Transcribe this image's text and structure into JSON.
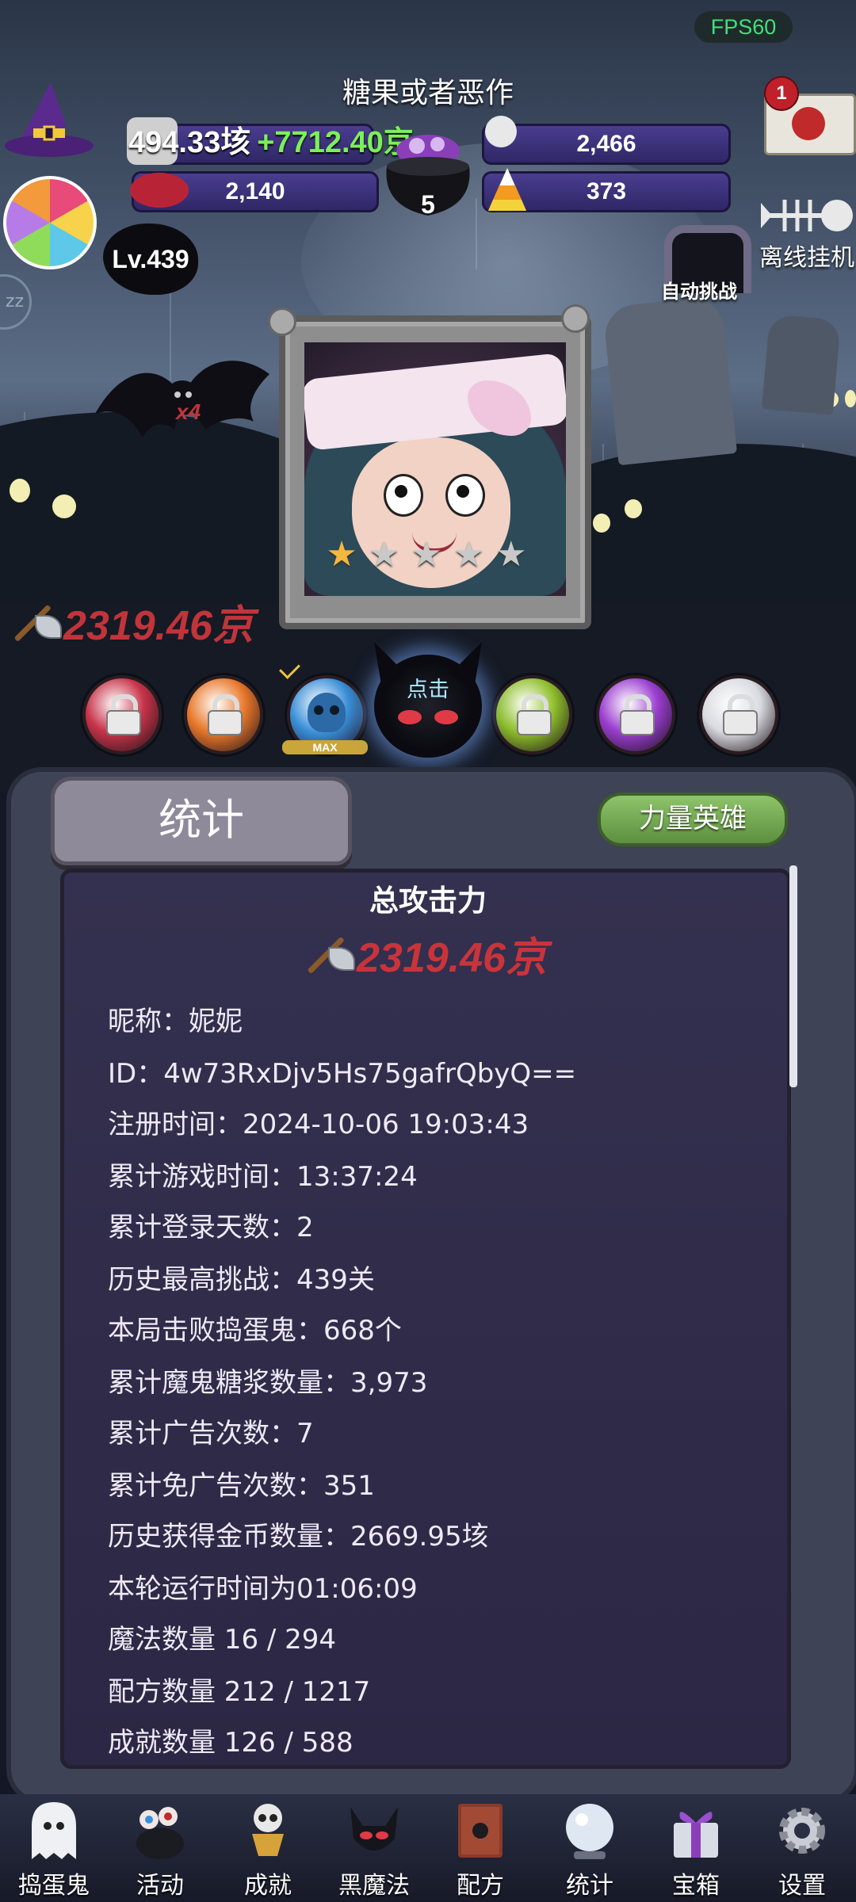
{
  "status": {
    "fps": "FPS60"
  },
  "header": {
    "title": "糖果或者恶作",
    "gold": "494.33垓",
    "gold_rate": "+7712.40京",
    "skulls": "2,466",
    "bats": "2,140",
    "cauldron_count": "5",
    "candy_corn": "373",
    "mail_badge": "1",
    "level": "Lv.439",
    "auto_challenge": "自动挑战",
    "offline_idle": "离线挂机"
  },
  "hero": {
    "stars_filled": 1,
    "stars_total": 5,
    "attack": "2319.46京",
    "max_label": "MAX",
    "tap_label": "点击"
  },
  "bat_multiplier": "x4",
  "orbs": [
    {
      "color": "#c8344a",
      "locked": true
    },
    {
      "color": "#e8782a",
      "locked": true
    },
    {
      "color": "#3a8fd8",
      "locked": false,
      "max": true
    },
    {
      "color": "#8fbf2c",
      "locked": true
    },
    {
      "color": "#9a3ed0",
      "locked": true
    },
    {
      "color": "#d9dbe0",
      "locked": true
    }
  ],
  "panel": {
    "tab_active": "统计",
    "tab_other": "力量英雄",
    "total_attack_title": "总攻击力",
    "total_attack_value": "2319.46京",
    "stats": [
      "昵称：妮妮",
      "ID：4w73RxDjv5Hs75gafrQbyQ==",
      "注册时间：2024-10-06 19:03:43",
      "累计游戏时间：13:37:24",
      "累计登录天数：2",
      "历史最高挑战：439关",
      "本局击败捣蛋鬼：668个",
      "累计魔鬼糖浆数量：3,973",
      "累计广告次数：7",
      "累计免广告次数：351",
      "历史获得金币数量：2669.95垓",
      "本轮运行时间为01:06:09",
      "魔法数量 16 / 294",
      "配方数量 212 / 1217",
      "成就数量 126 / 588"
    ]
  },
  "nav": [
    {
      "label": "捣蛋鬼",
      "icon": "ghost-icon"
    },
    {
      "label": "活动",
      "icon": "eyeball-cauldron-icon"
    },
    {
      "label": "成就",
      "icon": "skull-trophy-icon"
    },
    {
      "label": "黑魔法",
      "icon": "demon-icon"
    },
    {
      "label": "配方",
      "icon": "spellbook-icon"
    },
    {
      "label": "统计",
      "icon": "crystal-ball-icon"
    },
    {
      "label": "宝箱",
      "icon": "gift-chest-icon"
    },
    {
      "label": "设置",
      "icon": "gear-icon"
    }
  ]
}
